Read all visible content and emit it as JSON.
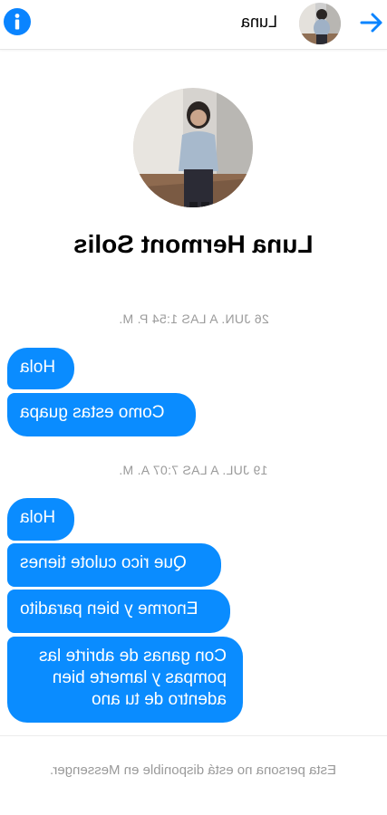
{
  "header": {
    "contact_name": "Luna",
    "info_icon": "info-icon",
    "back_icon": "arrow-icon"
  },
  "profile": {
    "full_name": "Luna Hermont Solis"
  },
  "conversation": [
    {
      "timestamp": "26 JUN. A LAS 1:54 P. M.",
      "messages": [
        "Hola",
        "Como estas guapa"
      ]
    },
    {
      "timestamp": "19 JUL. A LAS 7:07 A. M.",
      "messages": [
        "Hola",
        "Que rico culote tienes",
        "Enorme y bien paradito",
        "Con ganas de abrirte las pompas y lamerte bien adentro de tu ano"
      ]
    }
  ],
  "footer": {
    "notice": "Esta persona no está disponible en Messenger."
  },
  "colors": {
    "accent": "#0a84ff",
    "bubble": "#0a8cff",
    "muted_text": "#9a9a9a"
  }
}
